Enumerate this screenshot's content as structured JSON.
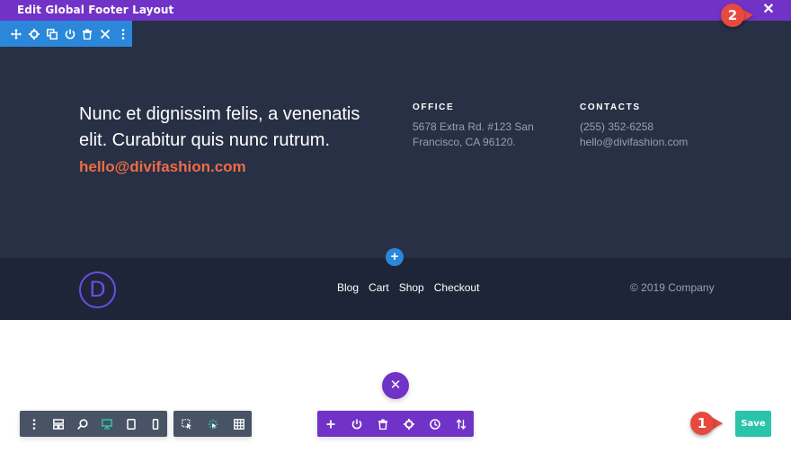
{
  "topbar": {
    "title": "Edit Global Footer Layout"
  },
  "badges": {
    "close_badge": "2",
    "save_badge": "1"
  },
  "section_toolbar": {
    "icons": [
      "move-icon",
      "gear-icon",
      "duplicate-icon",
      "power-icon",
      "trash-icon",
      "close-icon",
      "more-icon"
    ]
  },
  "footer": {
    "headline": "Nunc et dignissim felis, a venenatis elit. Curabitur quis nunc rutrum.",
    "email": "hello@divifashion.com",
    "office": {
      "heading": "OFFICE",
      "line1": "5678 Extra Rd. #123 San",
      "line2": "Francisco, CA 96120."
    },
    "contacts": {
      "heading": "CONTACTS",
      "phone": "(255) 352-6258",
      "email": "hello@divifashion.com"
    },
    "add_row": "+",
    "logo_letter": "D",
    "nav": [
      "Blog",
      "Cart",
      "Shop",
      "Checkout"
    ],
    "copyright": "© 2019 Company"
  },
  "dock": {
    "close": "✕",
    "left_icons": [
      "more-icon",
      "wireframe-icon",
      "zoom-icon",
      "desktop-icon",
      "tablet-icon",
      "phone-icon"
    ],
    "mid_icons": [
      "click-mode-icon",
      "hover-mode-icon",
      "grid-icon"
    ],
    "purple_icons": [
      "add-icon",
      "power-icon",
      "trash-icon",
      "gear-icon",
      "history-icon",
      "sort-icon"
    ],
    "save_label": "Save"
  },
  "colors": {
    "purple": "#7133c7",
    "blue": "#2b87da",
    "footer_dark": "#273045",
    "footer_darker": "#1e2538",
    "accent_orange": "#ee6b45",
    "save_green": "#29c4a9",
    "badge_red": "#e8493f",
    "dock_gray": "#495366"
  }
}
